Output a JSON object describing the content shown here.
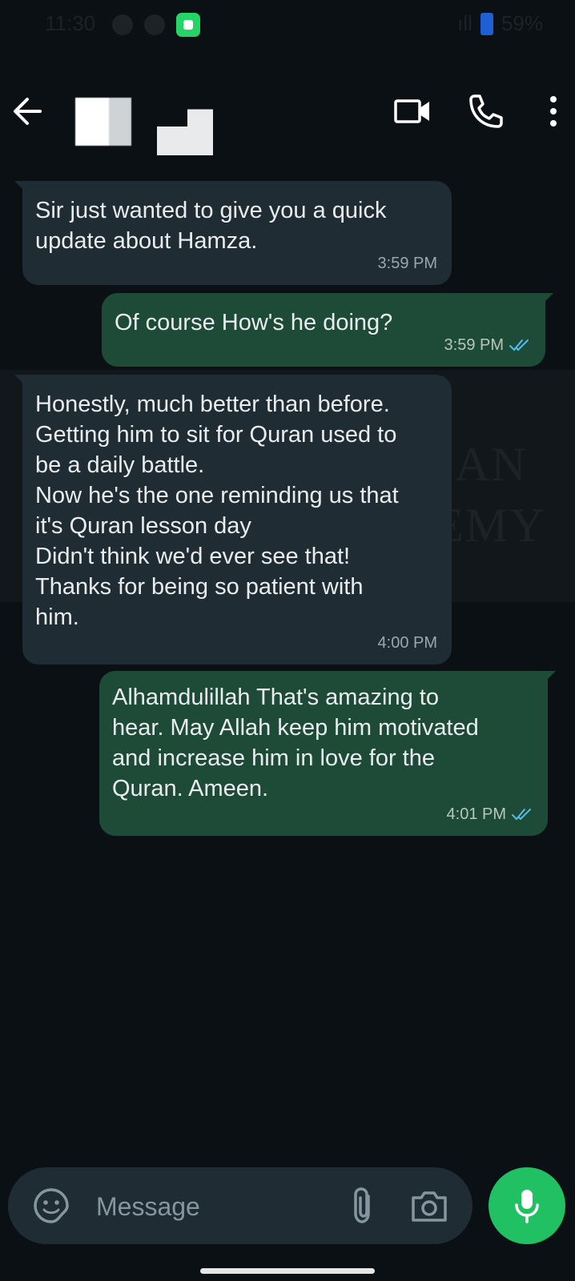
{
  "status_bar": {
    "time": "11:30",
    "battery": "59%"
  },
  "header": {
    "icons": [
      "back-arrow-icon",
      "video-call-icon",
      "phone-icon",
      "more-vertical-icon"
    ]
  },
  "watermark": {
    "line1": "RAHMAN",
    "line2": "AN ACADEMY"
  },
  "messages": [
    {
      "direction": "incoming",
      "text": "Sir just wanted to give you a quick\nupdate about Hamza.",
      "time": "3:59 PM"
    },
    {
      "direction": "outgoing",
      "text": "Of course How's he doing?",
      "time": "3:59 PM",
      "status": "read"
    },
    {
      "direction": "incoming",
      "text": "Honestly, much better than before.\nGetting him to sit for Quran used to\nbe a daily battle.\nNow he's the one reminding us that\nit's Quran lesson day\nDidn't think we'd ever see that!\nThanks for being so patient with\nhim.",
      "time": "4:00 PM"
    },
    {
      "direction": "outgoing",
      "text": "Alhamdulillah  That's amazing to\nhear. May Allah keep him motivated\nand increase him in love for the\nQuran. Ameen.",
      "time": "4:01 PM",
      "status": "read"
    }
  ],
  "composer": {
    "placeholder": "Message",
    "value": "",
    "icons": [
      "emoji-sticker-icon",
      "paperclip-icon",
      "camera-icon",
      "microphone-icon"
    ]
  },
  "colors": {
    "background": "#0b1014",
    "incoming_bubble": "#202c33",
    "outgoing_bubble": "#1e4a38",
    "read_ticks": "#53bdeb",
    "mic_button": "#21c063"
  }
}
